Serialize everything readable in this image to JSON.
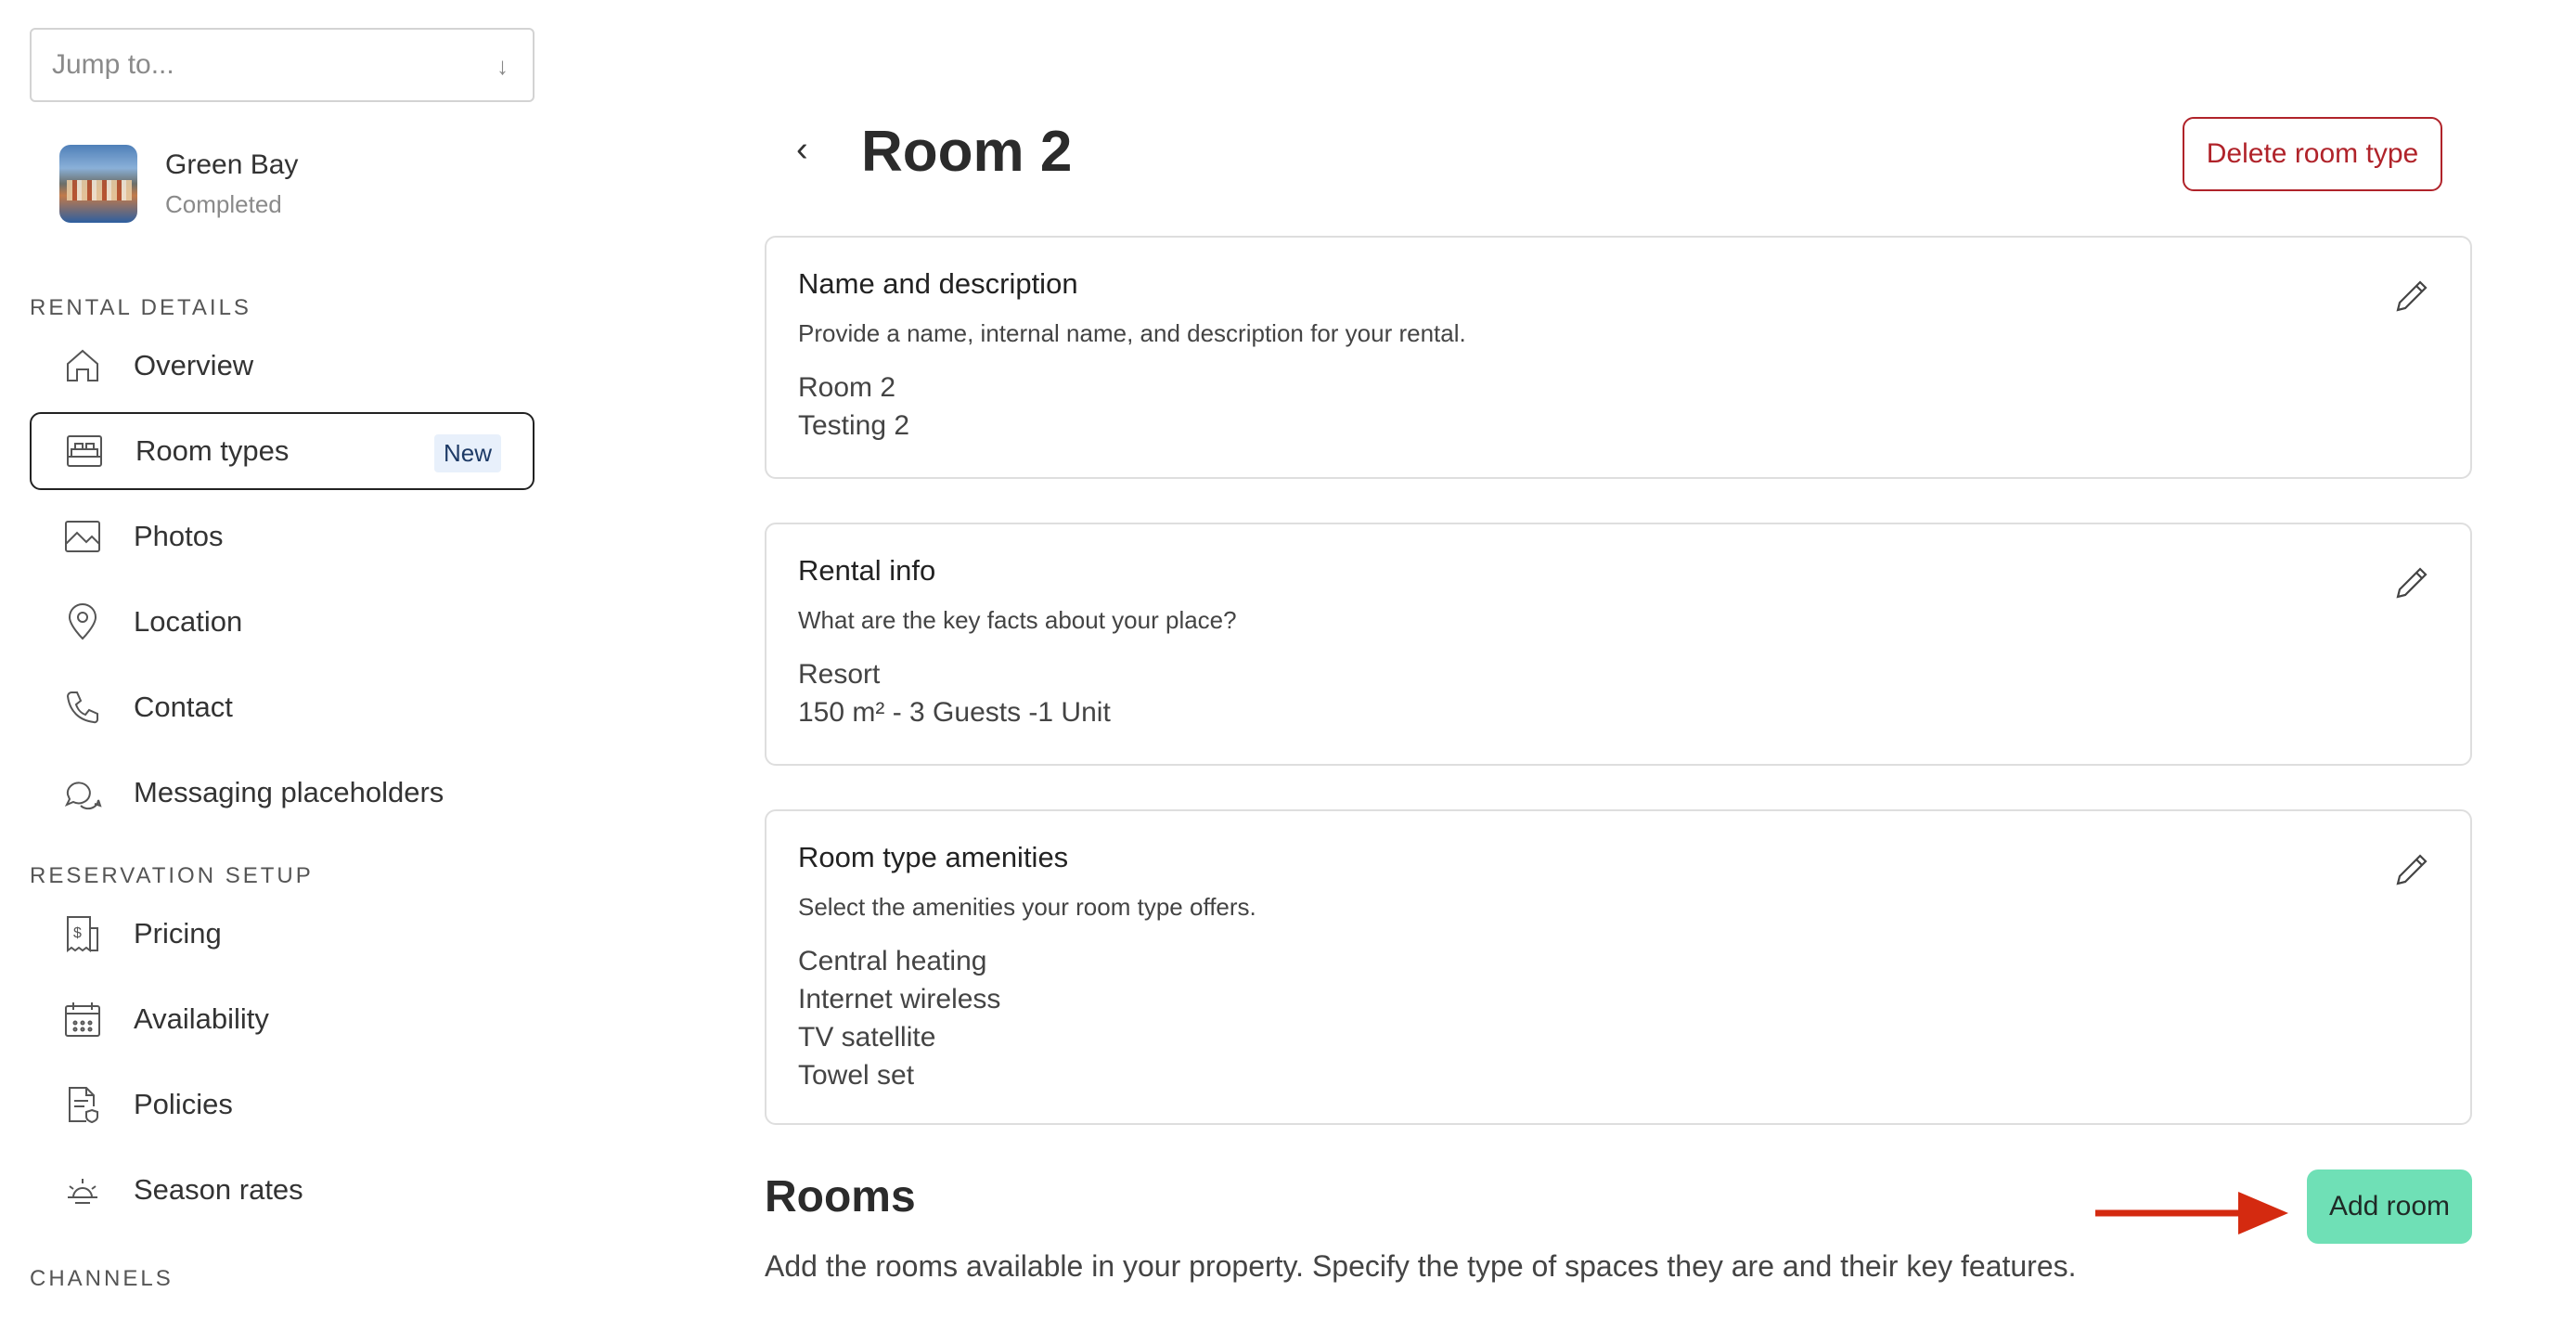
{
  "sidebar": {
    "jump_placeholder": "Jump to...",
    "property": {
      "name": "Green Bay",
      "status": "Completed"
    },
    "sections": {
      "rental_details": "RENTAL DETAILS",
      "reservation_setup": "RESERVATION SETUP",
      "channels": "CHANNELS"
    },
    "items": {
      "overview": "Overview",
      "room_types": "Room types",
      "room_types_badge": "New",
      "photos": "Photos",
      "location": "Location",
      "contact": "Contact",
      "messaging": "Messaging placeholders",
      "pricing": "Pricing",
      "availability": "Availability",
      "policies": "Policies",
      "season_rates": "Season rates"
    }
  },
  "header": {
    "back_symbol": "‹",
    "title": "Room 2",
    "delete_label": "Delete room type"
  },
  "cards": {
    "name": {
      "title": "Name and description",
      "desc": "Provide a name, internal name, and description for your rental.",
      "values": [
        "Room 2",
        "Testing 2"
      ]
    },
    "rental": {
      "title": "Rental info",
      "desc": "What are the key facts about your place?",
      "values": [
        "Resort",
        "150 m² - 3 Guests -1 Unit"
      ]
    },
    "amenities": {
      "title": "Room type amenities",
      "desc": "Select the amenities your room type offers.",
      "values": [
        "Central heating",
        "Internet wireless",
        "TV satellite",
        "Towel set"
      ]
    }
  },
  "rooms": {
    "title": "Rooms",
    "desc": "Add the rooms available in your property. Specify the type of spaces they are and their key features.",
    "add_label": "Add room"
  },
  "colors": {
    "delete": "#b0232a",
    "add_button": "#6fe0b6",
    "annotation_arrow": "#d42a10",
    "badge_bg": "#e8f0fb"
  },
  "icons": {
    "overview": "home-icon",
    "room_types": "bed-icon",
    "photos": "image-icon",
    "location": "map-pin-icon",
    "contact": "phone-icon",
    "messaging": "chat-bubbles-icon",
    "pricing": "price-tag-icon",
    "availability": "calendar-icon",
    "policies": "document-shield-icon",
    "season_rates": "sun-icon",
    "edit": "pencil-icon"
  }
}
